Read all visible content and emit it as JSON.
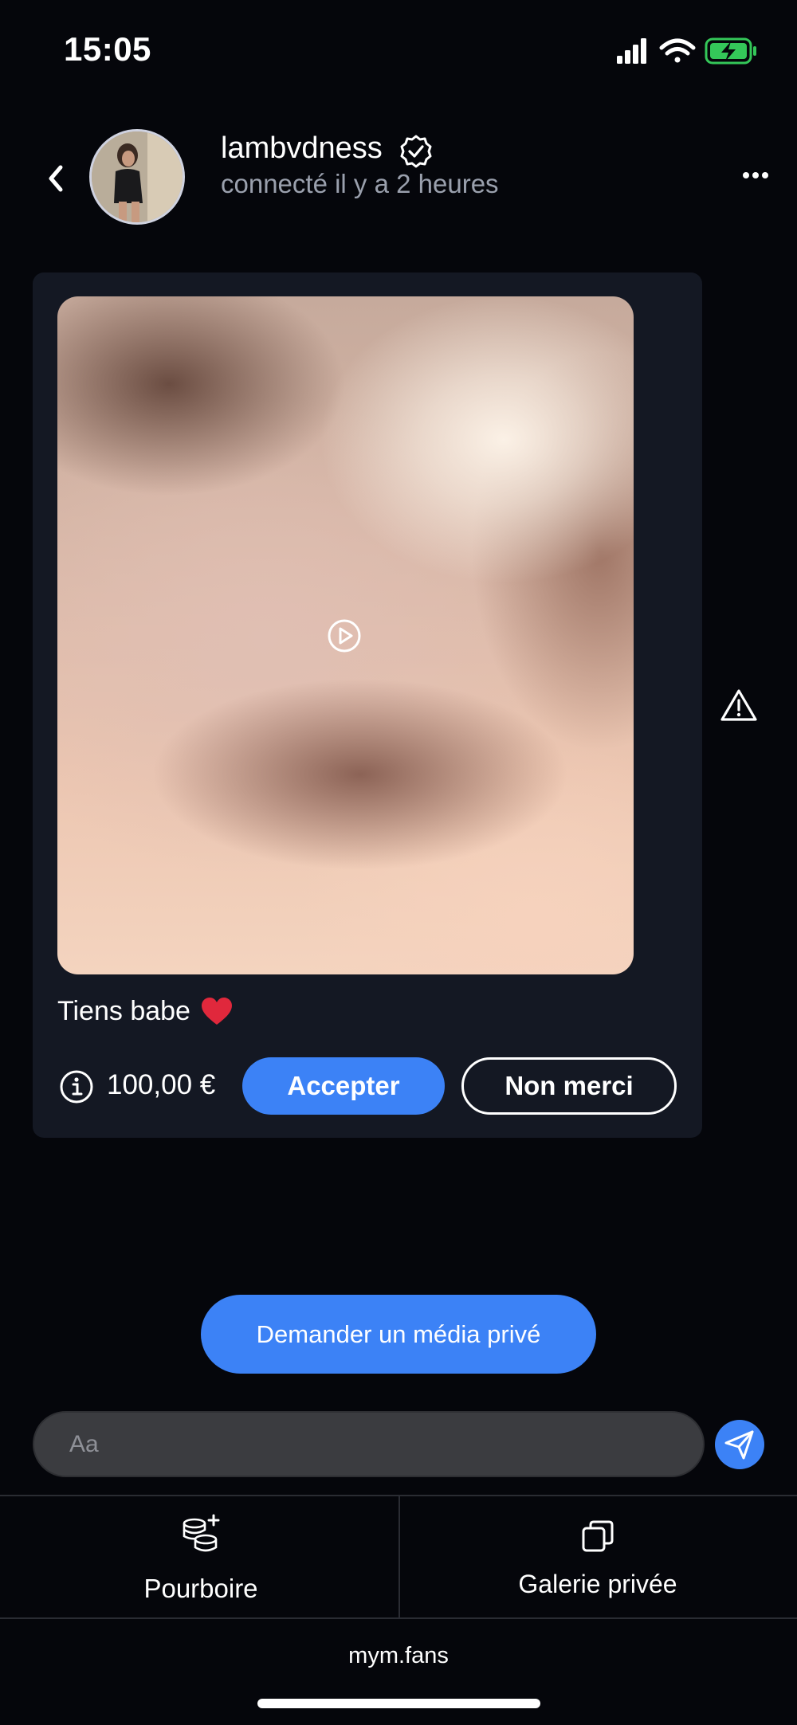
{
  "status_bar": {
    "time": "15:05",
    "battery_color": "#34c759",
    "icons": [
      "cellular-signal-icon",
      "wifi-icon",
      "battery-charging-icon"
    ]
  },
  "header": {
    "username": "lambvdness",
    "last_seen": "connecté il y a 2 heures",
    "icons": [
      "back-chevron-icon",
      "verified-badge-icon",
      "more-options-icon"
    ]
  },
  "message": {
    "caption": "Tiens babe",
    "caption_emoji": "heart-icon",
    "media_type": "video",
    "price": "100,00 €",
    "accept_label": "Accepter",
    "decline_label": "Non merci"
  },
  "request_button": {
    "label": "Demander un média privé"
  },
  "composer": {
    "placeholder": "Aa",
    "value": ""
  },
  "tabs": [
    {
      "label": "Pourboire",
      "icon": "coins-plus-icon"
    },
    {
      "label": "Galerie privée",
      "icon": "gallery-stack-icon"
    }
  ],
  "footer": {
    "domain": "mym.fans"
  },
  "colors": {
    "accent": "#3c82f6",
    "background": "#05060b",
    "bubble": "#141823",
    "heart": "#e0283c"
  }
}
